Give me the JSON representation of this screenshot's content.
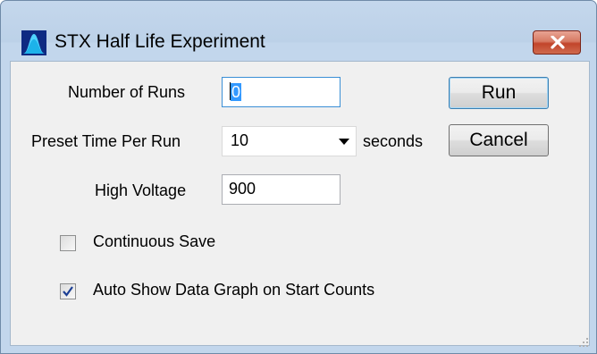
{
  "window": {
    "title": "STX Half Life Experiment",
    "icon": "bell-curve-icon",
    "close_icon": "close-icon"
  },
  "form": {
    "runs_label": "Number of Runs",
    "runs_value": "0",
    "preset_label": "Preset Time Per Run",
    "preset_value": "10",
    "preset_unit": "seconds",
    "voltage_label": "High Voltage",
    "voltage_value": "900"
  },
  "buttons": {
    "run": "Run",
    "cancel": "Cancel"
  },
  "options": {
    "continuous_save_label": "Continuous Save",
    "continuous_save_checked": false,
    "auto_show_label": "Auto Show Data Graph on Start Counts",
    "auto_show_checked": true
  },
  "colors": {
    "title_bg": "#bcd1e8",
    "close_red": "#c2452b",
    "selection": "#3399ff"
  }
}
